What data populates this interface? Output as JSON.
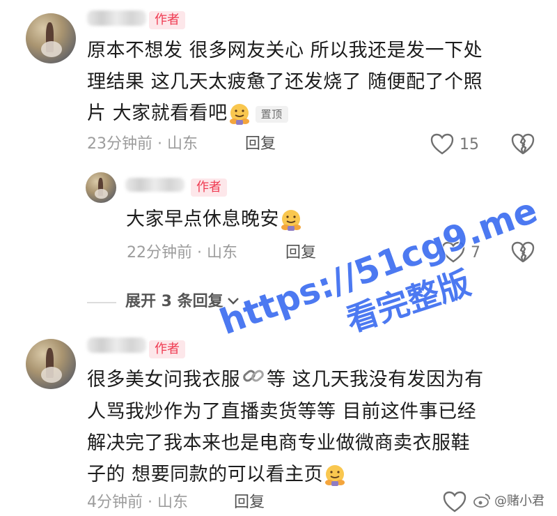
{
  "comments": [
    {
      "badge": "作者",
      "text_lines": [
        "原本不想发 很多网友关心 所以我还是发一下处",
        "理结果 这几天太疲惫了还发烧了 随便配了个照",
        "片 大家就看看吧"
      ],
      "pinned": "置顶",
      "time_location": "23分钟前 · 山东",
      "reply_label": "回复",
      "like_count": "15"
    },
    {
      "badge": "作者",
      "text_lines": [
        "大家早点休息晚安"
      ],
      "time_location": "22分钟前 · 山东",
      "reply_label": "回复",
      "like_count": "7"
    },
    {
      "badge": "作者",
      "text_lines": [
        "很多美女问我衣服",
        "等 这几天我没有发因为有",
        "人骂我炒作为了直播卖货等等 目前这件事已经",
        "解决完了我本来也是电商专业做微商卖衣服鞋",
        "子的 想要同款的可以看主页"
      ],
      "time_location": "4分钟前 · 山东",
      "reply_label": "回复"
    }
  ],
  "expand_replies": "展开 3 条回复",
  "watermark": {
    "line1": "https://51cg9.me",
    "line2": "看完整版"
  },
  "weibo_handle": "@赌小君",
  "colors": {
    "badge_bg": "#fde7ea",
    "badge_text": "#ef3b52",
    "watermark": "#3d6ef0"
  },
  "icons": [
    "heart-icon",
    "broken-heart-icon",
    "hug-emoji-icon",
    "link-icon",
    "chevron-down-icon",
    "weibo-icon"
  ]
}
